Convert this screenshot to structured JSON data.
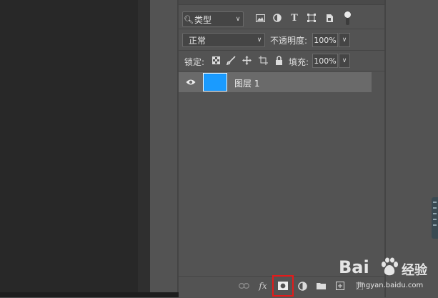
{
  "layers_panel": {
    "filter": {
      "kind_label": "类型"
    },
    "blend_mode": "正常",
    "opacity_label": "不透明度:",
    "opacity_value": "100%",
    "lock_label": "锁定:",
    "fill_label": "填充:",
    "fill_value": "100%",
    "layers": [
      {
        "name": "图层 1",
        "visible": true,
        "thumbnail_color": "#1a9bff"
      }
    ],
    "bottom_icons": [
      "link-icon",
      "fx-icon",
      "add-mask-icon",
      "adjustment-icon",
      "folder-icon",
      "new-layer-icon",
      "trash-icon"
    ],
    "fx_label": "fx"
  },
  "highlight_color": "#e31b1b",
  "watermark": {
    "brand": "Bai",
    "brand_suffix": "经验",
    "url": "jingyan.baidu.com"
  }
}
